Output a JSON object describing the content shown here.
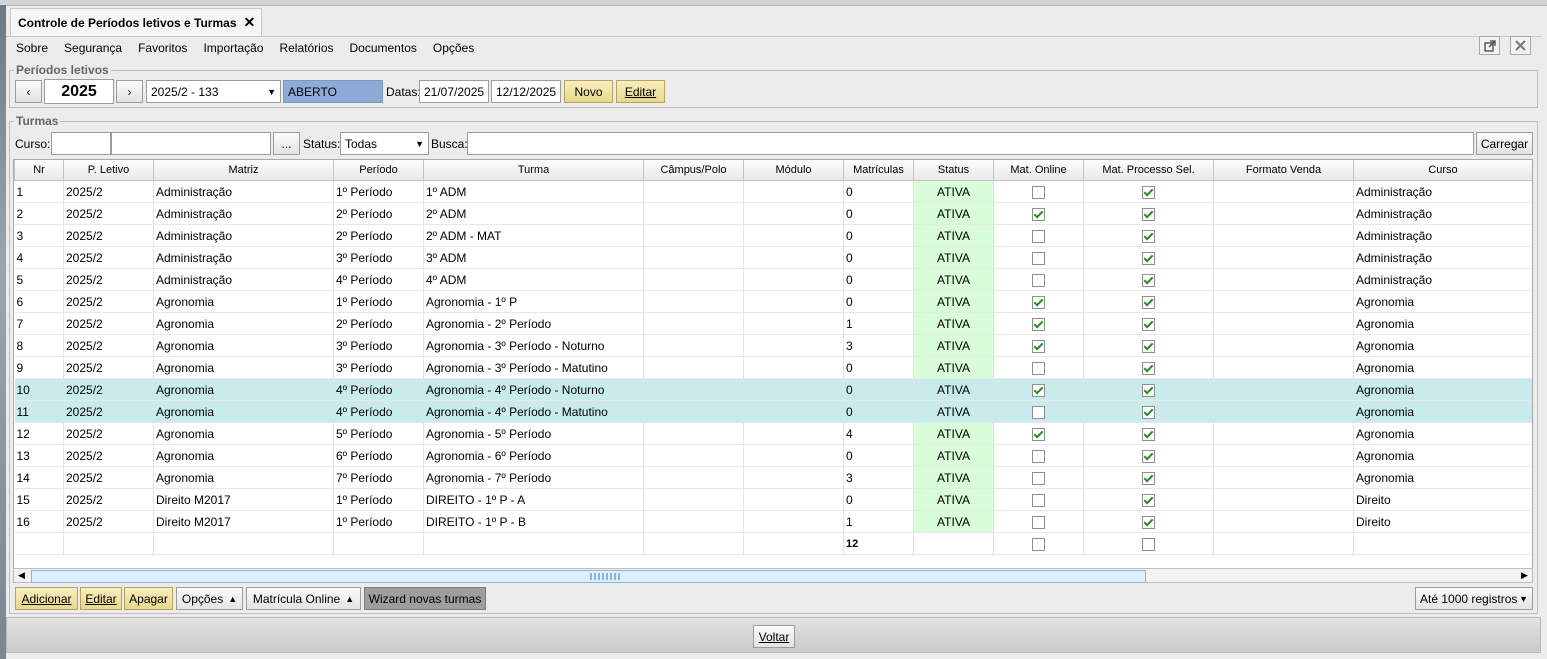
{
  "tab": {
    "title": "Controle de Períodos letivos e Turmas",
    "close": "✕"
  },
  "menu": [
    "Sobre",
    "Segurança",
    "Favoritos",
    "Importação",
    "Relatórios",
    "Documentos",
    "Opções"
  ],
  "periodos": {
    "legend": "Períodos letivos",
    "prev": "‹",
    "year": "2025",
    "next": "›",
    "period_select": "2025/2 - 133",
    "status": "ABERTO",
    "status_color": "#8cabd6",
    "datas_label": "Datas:",
    "date_start": "21/07/2025",
    "date_end": "12/12/2025",
    "novo": "Novo",
    "editar": "Editar"
  },
  "turmas": {
    "legend": "Turmas",
    "curso_label": "Curso:",
    "curso_code": "",
    "curso_name": "",
    "ellipsis": "...",
    "status_label": "Status:",
    "status_value": "Todas",
    "busca_label": "Busca:",
    "busca_value": "",
    "carregar": "Carregar"
  },
  "table": {
    "columns": [
      "Nr",
      "P. Letivo",
      "Matriz",
      "Período",
      "Turma",
      "Câmpus/Polo",
      "Módulo",
      "Matrículas",
      "Status",
      "Mat. Online",
      "Mat. Processo Sel.",
      "Formato Venda",
      "Curso"
    ],
    "rows": [
      {
        "nr": "1",
        "pletivo": "2025/2",
        "matriz": "Administração",
        "periodo": "1º Período",
        "turma": "1º ADM",
        "campus": "",
        "modulo": "",
        "matriculas": "0",
        "status": "ATIVA",
        "online": false,
        "processo": true,
        "formato": "",
        "curso": "Administração",
        "selected": false
      },
      {
        "nr": "2",
        "pletivo": "2025/2",
        "matriz": "Administração",
        "periodo": "2º Período",
        "turma": "2º ADM",
        "campus": "",
        "modulo": "",
        "matriculas": "0",
        "status": "ATIVA",
        "online": true,
        "processo": true,
        "formato": "",
        "curso": "Administração",
        "selected": false
      },
      {
        "nr": "3",
        "pletivo": "2025/2",
        "matriz": "Administração",
        "periodo": "2º Período",
        "turma": "2º ADM - MAT",
        "campus": "",
        "modulo": "",
        "matriculas": "0",
        "status": "ATIVA",
        "online": false,
        "processo": true,
        "formato": "",
        "curso": "Administração",
        "selected": false
      },
      {
        "nr": "4",
        "pletivo": "2025/2",
        "matriz": "Administração",
        "periodo": "3º Período",
        "turma": "3º ADM",
        "campus": "",
        "modulo": "",
        "matriculas": "0",
        "status": "ATIVA",
        "online": false,
        "processo": true,
        "formato": "",
        "curso": "Administração",
        "selected": false
      },
      {
        "nr": "5",
        "pletivo": "2025/2",
        "matriz": "Administração",
        "periodo": "4º Período",
        "turma": "4º ADM",
        "campus": "",
        "modulo": "",
        "matriculas": "0",
        "status": "ATIVA",
        "online": false,
        "processo": true,
        "formato": "",
        "curso": "Administração",
        "selected": false
      },
      {
        "nr": "6",
        "pletivo": "2025/2",
        "matriz": "Agronomia",
        "periodo": "1º Período",
        "turma": "Agronomia - 1º P",
        "campus": "",
        "modulo": "",
        "matriculas": "0",
        "status": "ATIVA",
        "online": true,
        "processo": true,
        "formato": "",
        "curso": "Agronomia",
        "selected": false
      },
      {
        "nr": "7",
        "pletivo": "2025/2",
        "matriz": "Agronomia",
        "periodo": "2º Período",
        "turma": "Agronomia - 2º Período",
        "campus": "",
        "modulo": "",
        "matriculas": "1",
        "status": "ATIVA",
        "online": true,
        "processo": true,
        "formato": "",
        "curso": "Agronomia",
        "selected": false
      },
      {
        "nr": "8",
        "pletivo": "2025/2",
        "matriz": "Agronomia",
        "periodo": "3º Período",
        "turma": "Agronomia - 3º Período - Noturno",
        "campus": "",
        "modulo": "",
        "matriculas": "3",
        "status": "ATIVA",
        "online": true,
        "processo": true,
        "formato": "",
        "curso": "Agronomia",
        "selected": false
      },
      {
        "nr": "9",
        "pletivo": "2025/2",
        "matriz": "Agronomia",
        "periodo": "3º Período",
        "turma": "Agronomia - 3º Período - Matutino",
        "campus": "",
        "modulo": "",
        "matriculas": "0",
        "status": "ATIVA",
        "online": false,
        "processo": true,
        "formato": "",
        "curso": "Agronomia",
        "selected": false
      },
      {
        "nr": "10",
        "pletivo": "2025/2",
        "matriz": "Agronomia",
        "periodo": "4º Período",
        "turma": "Agronomia - 4º Período - Noturno",
        "campus": "",
        "modulo": "",
        "matriculas": "0",
        "status": "ATIVA",
        "online": true,
        "processo": true,
        "formato": "",
        "curso": "Agronomia",
        "selected": true
      },
      {
        "nr": "11",
        "pletivo": "2025/2",
        "matriz": "Agronomia",
        "periodo": "4º Período",
        "turma": "Agronomia - 4º Período - Matutino",
        "campus": "",
        "modulo": "",
        "matriculas": "0",
        "status": "ATIVA",
        "online": false,
        "processo": true,
        "formato": "",
        "curso": "Agronomia",
        "selected": true
      },
      {
        "nr": "12",
        "pletivo": "2025/2",
        "matriz": "Agronomia",
        "periodo": "5º Período",
        "turma": "Agronomia - 5º Período",
        "campus": "",
        "modulo": "",
        "matriculas": "4",
        "status": "ATIVA",
        "online": true,
        "processo": true,
        "formato": "",
        "curso": "Agronomia",
        "selected": false
      },
      {
        "nr": "13",
        "pletivo": "2025/2",
        "matriz": "Agronomia",
        "periodo": "6º Período",
        "turma": "Agronomia - 6º Período",
        "campus": "",
        "modulo": "",
        "matriculas": "0",
        "status": "ATIVA",
        "online": false,
        "processo": true,
        "formato": "",
        "curso": "Agronomia",
        "selected": false
      },
      {
        "nr": "14",
        "pletivo": "2025/2",
        "matriz": "Agronomia",
        "periodo": "7º Período",
        "turma": "Agronomia - 7º Período",
        "campus": "",
        "modulo": "",
        "matriculas": "3",
        "status": "ATIVA",
        "online": false,
        "processo": true,
        "formato": "",
        "curso": "Agronomia",
        "selected": false
      },
      {
        "nr": "15",
        "pletivo": "2025/2",
        "matriz": "Direito M2017",
        "periodo": "1º Período",
        "turma": "DIREITO - 1º P - A",
        "campus": "",
        "modulo": "",
        "matriculas": "0",
        "status": "ATIVA",
        "online": false,
        "processo": true,
        "formato": "",
        "curso": "Direito",
        "selected": false
      },
      {
        "nr": "16",
        "pletivo": "2025/2",
        "matriz": "Direito M2017",
        "periodo": "1º Período",
        "turma": "DIREITO - 1º P - B",
        "campus": "",
        "modulo": "",
        "matriculas": "1",
        "status": "ATIVA",
        "online": false,
        "processo": true,
        "formato": "",
        "curso": "Direito",
        "selected": false
      }
    ],
    "total_matriculas": "12",
    "status_bg": "#d9fcd9",
    "selected_bg": "#c9ebec"
  },
  "bottom": {
    "adicionar": "Adicionar",
    "editar": "Editar",
    "apagar": "Apagar",
    "opcoes": "Opções",
    "matricula_online": "Matrícula Online",
    "wizard": "Wizard novas turmas",
    "registros": "Até 1000 registros"
  },
  "footer": {
    "voltar": "Voltar"
  }
}
